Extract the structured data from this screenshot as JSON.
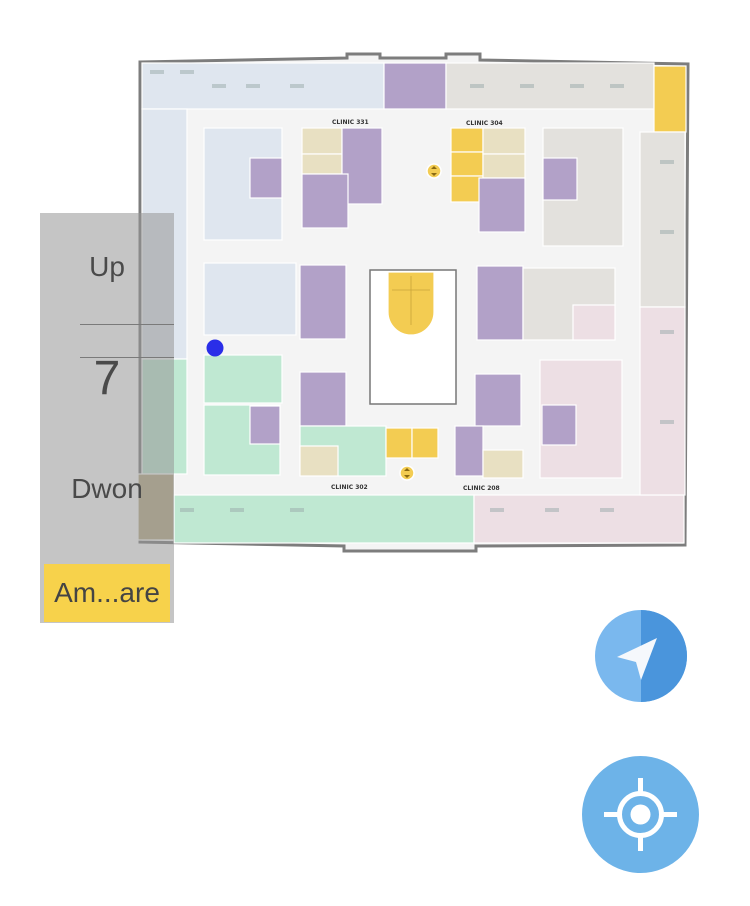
{
  "floor_control": {
    "up_label": "Up",
    "current_floor": "7",
    "down_label": "Dwon",
    "amenities_label": "Am...are"
  },
  "map": {
    "clinics": [
      "CLINIC 331",
      "CLINIC 304",
      "CLINIC 302",
      "CLINIC 208"
    ],
    "colors": {
      "blue_wing": "#dfe6ef",
      "green_wing": "#bfe8d2",
      "pink_wing": "#eddfe4",
      "gray_wing": "#e3e1dd",
      "purple_room": "#b2a1c8",
      "yellow_room": "#f3cc52",
      "tan_room": "#e8e0c2",
      "user_location": "#2a2ee8"
    }
  },
  "controls": {
    "compass_icon": "navigation-arrow-icon",
    "locate_icon": "crosshair-icon",
    "compass_colors": [
      "#4a95dc",
      "#7ab8ee"
    ],
    "locate_color": "#6db3e8"
  }
}
